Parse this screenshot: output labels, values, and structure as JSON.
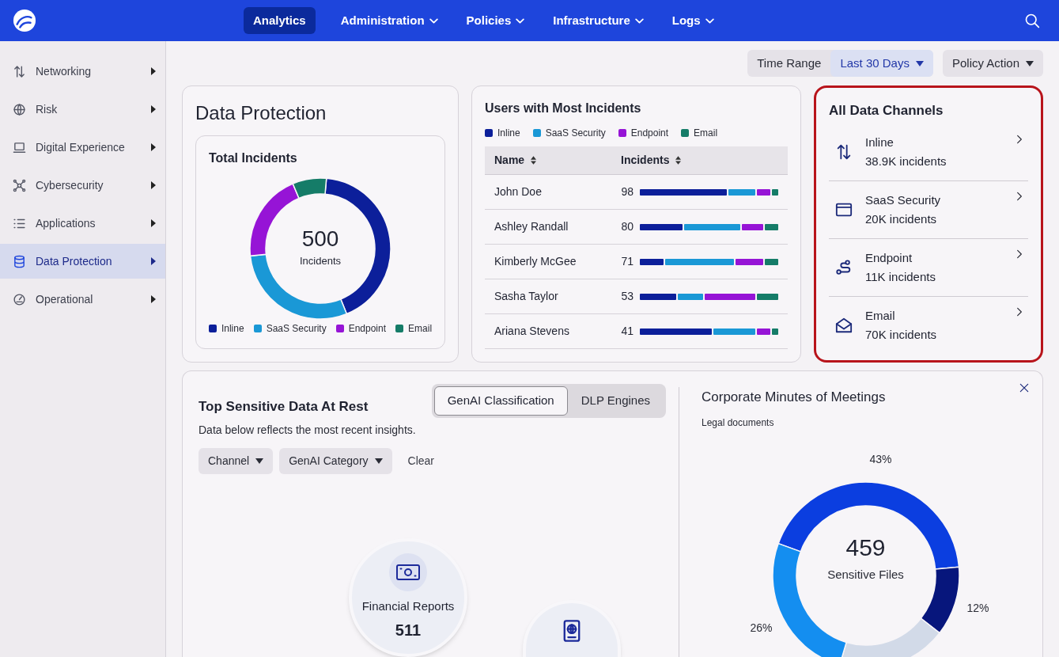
{
  "nav": {
    "tabs": [
      {
        "label": "Analytics",
        "selected": true,
        "menu": false
      },
      {
        "label": "Administration",
        "selected": false,
        "menu": true
      },
      {
        "label": "Policies",
        "selected": false,
        "menu": true
      },
      {
        "label": "Infrastructure",
        "selected": false,
        "menu": true
      },
      {
        "label": "Logs",
        "selected": false,
        "menu": true
      }
    ]
  },
  "sidebar": {
    "items": [
      {
        "kind": "networking",
        "label": "Networking",
        "selected": false
      },
      {
        "kind": "risk",
        "label": "Risk",
        "selected": false
      },
      {
        "kind": "experience",
        "label": "Digital Experience",
        "selected": false
      },
      {
        "kind": "cybersecurity",
        "label": "Cybersecurity",
        "selected": false
      },
      {
        "kind": "applications",
        "label": "Applications",
        "selected": false
      },
      {
        "kind": "data",
        "label": "Data Protection",
        "selected": true
      },
      {
        "kind": "operational",
        "label": "Operational",
        "selected": false
      }
    ]
  },
  "toolbar": {
    "time_range_label": "Time Range",
    "time_range": "Last 30 Days",
    "policy_action": "Policy Action"
  },
  "data_protection": {
    "title": "Data Protection",
    "total_incidents": {
      "title": "Total Incidents",
      "total": "500",
      "total_label": "Incidents",
      "legend": [
        {
          "label": "Inline",
          "color": "#0c1f9a"
        },
        {
          "label": "SaaS Security",
          "color": "#1a98d6"
        },
        {
          "label": "Endpoint",
          "color": "#9614d6"
        },
        {
          "label": "Email",
          "color": "#157c68"
        }
      ]
    }
  },
  "users_with_most_incidents": {
    "title": "Users with Most Incidents",
    "legend": [
      {
        "label": "Inline",
        "color": "#0c1f9a"
      },
      {
        "label": "SaaS Security",
        "color": "#1a98d6"
      },
      {
        "label": "Endpoint",
        "color": "#9614d6"
      },
      {
        "label": "Email",
        "color": "#157c68"
      }
    ],
    "columns": [
      {
        "label": "Name",
        "sortable": true
      },
      {
        "label": "Incidents",
        "sortable": true
      }
    ],
    "rows": [
      {
        "name": "John Doe",
        "incidents": "98"
      },
      {
        "name": "Ashley Randall",
        "incidents": "80"
      },
      {
        "name": "Kimberly McGee",
        "incidents": "71"
      },
      {
        "name": "Sasha Taylor",
        "incidents": "53"
      },
      {
        "name": "Ariana Stevens",
        "incidents": "41"
      }
    ]
  },
  "all_data_channels": {
    "title": "All Data Channels",
    "items": [
      {
        "kind": "inline",
        "name": "Inline",
        "count": "38.9K incidents"
      },
      {
        "kind": "saas",
        "name": "SaaS Security",
        "count": "20K incidents"
      },
      {
        "kind": "endpoint",
        "name": "Endpoint",
        "count": "11K incidents"
      },
      {
        "kind": "email",
        "name": "Email",
        "count": "70K incidents"
      }
    ]
  },
  "top_sensitive_data": {
    "title": "Top Sensitive Data At Rest",
    "subtitle": "Data below reflects the most recent insights.",
    "tabs": [
      {
        "label": "GenAI Classification",
        "selected": true
      },
      {
        "label": "DLP Engines",
        "selected": false
      }
    ],
    "filters": [
      {
        "label": "Channel"
      },
      {
        "label": "GenAI Category"
      }
    ],
    "clear": "Clear",
    "categories": [
      {
        "kind": "finance",
        "label": "Financial Reports",
        "count": "511"
      },
      {
        "kind": "passport"
      }
    ]
  },
  "detail_panel": {
    "title": "Corporate Minutes of Meetings",
    "subtitle": "Legal documents",
    "total": "459",
    "total_label": "Sensitive Files",
    "chart_data": {
      "type": "donut",
      "values": [
        43,
        12,
        19,
        26
      ],
      "value_labels": [
        "43%",
        "12%",
        null,
        "26%"
      ],
      "colors": [
        "#0b3ee0",
        "#07167c",
        "#d2dae8",
        "#148ef0"
      ]
    }
  }
}
